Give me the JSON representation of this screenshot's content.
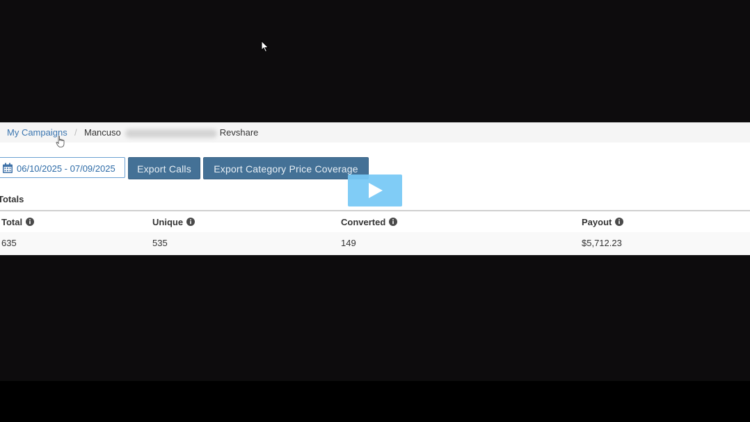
{
  "breadcrumb": {
    "link_label": "My Campaigns",
    "separator": "/",
    "current_prefix": "Mancuso",
    "current_suffix": "Revshare"
  },
  "toolbar": {
    "date_range": "06/10/2025 - 07/09/2025",
    "export_calls_label": "Export Calls",
    "export_category_label": "Export Category Price Coverage"
  },
  "totals": {
    "heading": "Totals",
    "columns": [
      "Total",
      "Unique",
      "Converted",
      "Payout"
    ],
    "values": [
      "635",
      "535",
      "149",
      "$5,712.23"
    ]
  },
  "icons": {
    "calendar": "calendar-icon",
    "info": "info-circle-icon",
    "play": "play-icon"
  },
  "colors": {
    "link": "#3a75b0",
    "button_bg": "#447196",
    "play_overlay": "#76c8f5",
    "backdrop": "#0d0c0d"
  }
}
